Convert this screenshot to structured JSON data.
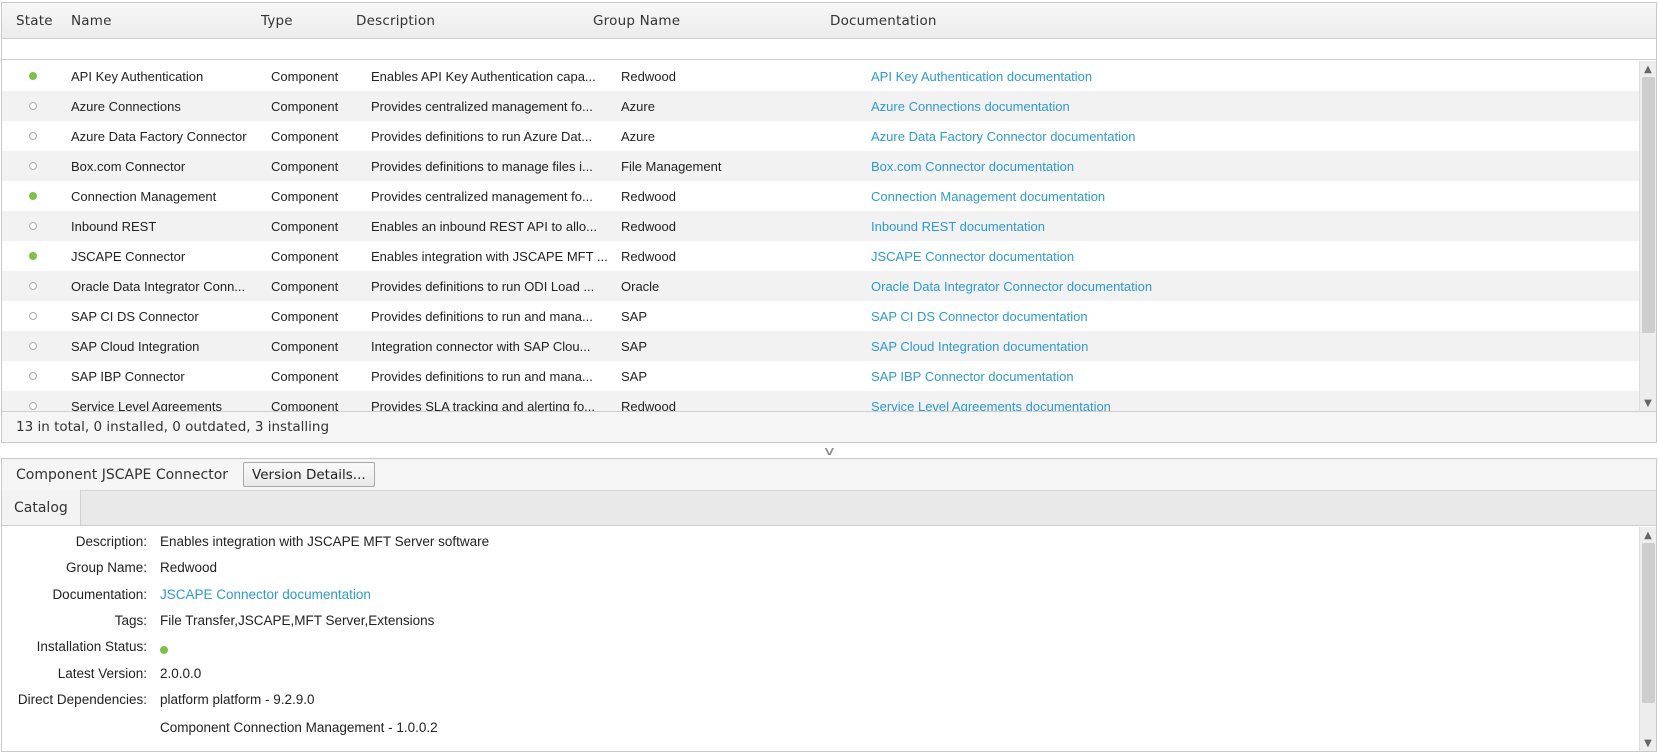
{
  "grid": {
    "columns": [
      "State",
      "Name",
      "Type",
      "Description",
      "Group Name",
      "Documentation"
    ],
    "rows": [
      {
        "state": "installed",
        "name": "API Key Authentication",
        "type": "Component",
        "description": "Enables API Key Authentication capa...",
        "group": "Redwood",
        "doc": "API Key Authentication documentation"
      },
      {
        "state": "not-installed",
        "name": "Azure Connections",
        "type": "Component",
        "description": "Provides centralized management fo...",
        "group": "Azure",
        "doc": "Azure Connections documentation"
      },
      {
        "state": "not-installed",
        "name": "Azure Data Factory Connector",
        "type": "Component",
        "description": "Provides definitions to run Azure Dat...",
        "group": "Azure",
        "doc": "Azure Data Factory Connector documentation"
      },
      {
        "state": "not-installed",
        "name": "Box.com Connector",
        "type": "Component",
        "description": "Provides definitions to manage files i...",
        "group": "File Management",
        "doc": "Box.com Connector documentation"
      },
      {
        "state": "installed",
        "name": "Connection Management",
        "type": "Component",
        "description": "Provides centralized management fo...",
        "group": "Redwood",
        "doc": "Connection Management documentation"
      },
      {
        "state": "not-installed",
        "name": "Inbound REST",
        "type": "Component",
        "description": "Enables an inbound REST API to allo...",
        "group": "Redwood",
        "doc": "Inbound REST documentation"
      },
      {
        "state": "installed",
        "name": "JSCAPE Connector",
        "type": "Component",
        "description": "Enables integration with JSCAPE MFT ...",
        "group": "Redwood",
        "doc": "JSCAPE Connector documentation"
      },
      {
        "state": "not-installed",
        "name": "Oracle Data Integrator Conn...",
        "type": "Component",
        "description": "Provides definitions to run ODI Load ...",
        "group": "Oracle",
        "doc": "Oracle Data Integrator Connector documentation"
      },
      {
        "state": "not-installed",
        "name": "SAP CI DS Connector",
        "type": "Component",
        "description": "Provides definitions to run and mana...",
        "group": "SAP",
        "doc": "SAP CI DS Connector documentation"
      },
      {
        "state": "not-installed",
        "name": "SAP Cloud Integration",
        "type": "Component",
        "description": "Integration connector with SAP Clou...",
        "group": "SAP",
        "doc": "SAP Cloud Integration documentation"
      },
      {
        "state": "not-installed",
        "name": "SAP IBP Connector",
        "type": "Component",
        "description": "Provides definitions to run and mana...",
        "group": "SAP",
        "doc": "SAP IBP Connector documentation"
      },
      {
        "state": "not-installed",
        "name": "Service Level Agreements",
        "type": "Component",
        "description": "Provides SLA tracking and alerting fo...",
        "group": "Redwood",
        "doc": "Service Level Agreements documentation"
      }
    ],
    "summary": "13 in total, 0 installed, 0 outdated, 3 installing"
  },
  "detail": {
    "title": "Component JSCAPE Connector",
    "version_button": "Version Details...",
    "tabs": [
      "Catalog"
    ],
    "properties": {
      "description_label": "Description:",
      "description": "Enables integration with JSCAPE MFT Server software",
      "group_label": "Group Name:",
      "group": "Redwood",
      "doc_label": "Documentation:",
      "doc": "JSCAPE Connector documentation",
      "tags_label": "Tags:",
      "tags": "File Transfer,JSCAPE,MFT Server,Extensions",
      "status_label": "Installation Status:",
      "status": "installed",
      "version_label": "Latest Version:",
      "version": "2.0.0.0",
      "deps_label": "Direct Dependencies:",
      "deps": [
        "platform platform - 9.2.9.0",
        "Component Connection Management - 1.0.0.2"
      ]
    }
  },
  "colors": {
    "link": "#2a9bd6",
    "installed": "#7cc243"
  },
  "icons": {
    "splitter": "chevron-down-icon",
    "scroll_up": "scroll-up-arrow-icon",
    "scroll_down": "scroll-down-arrow-icon"
  }
}
